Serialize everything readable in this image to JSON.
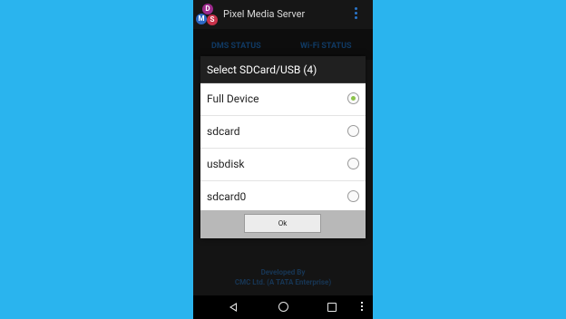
{
  "app": {
    "title": "Pixel Media Server",
    "logo_letters": [
      "D",
      "M",
      "S"
    ]
  },
  "background": {
    "tabs": [
      "DMS STATUS",
      "Wi-Fi STATUS"
    ],
    "footer_line1": "Developed By",
    "footer_line2": "CMC Ltd. (A TATA Enterprise)"
  },
  "dialog": {
    "title": "Select SDCard/USB (4)",
    "options": [
      {
        "label": "Full Device",
        "selected": true
      },
      {
        "label": "sdcard",
        "selected": false
      },
      {
        "label": "usbdisk",
        "selected": false
      },
      {
        "label": "sdcard0",
        "selected": false
      }
    ],
    "ok_label": "Ok"
  },
  "colors": {
    "page_background": "#2ab4ee",
    "radio_selected": "#8bc34a"
  },
  "icons": [
    "more-vert-icon",
    "back-icon",
    "home-icon",
    "recents-icon",
    "menu-icon"
  ]
}
